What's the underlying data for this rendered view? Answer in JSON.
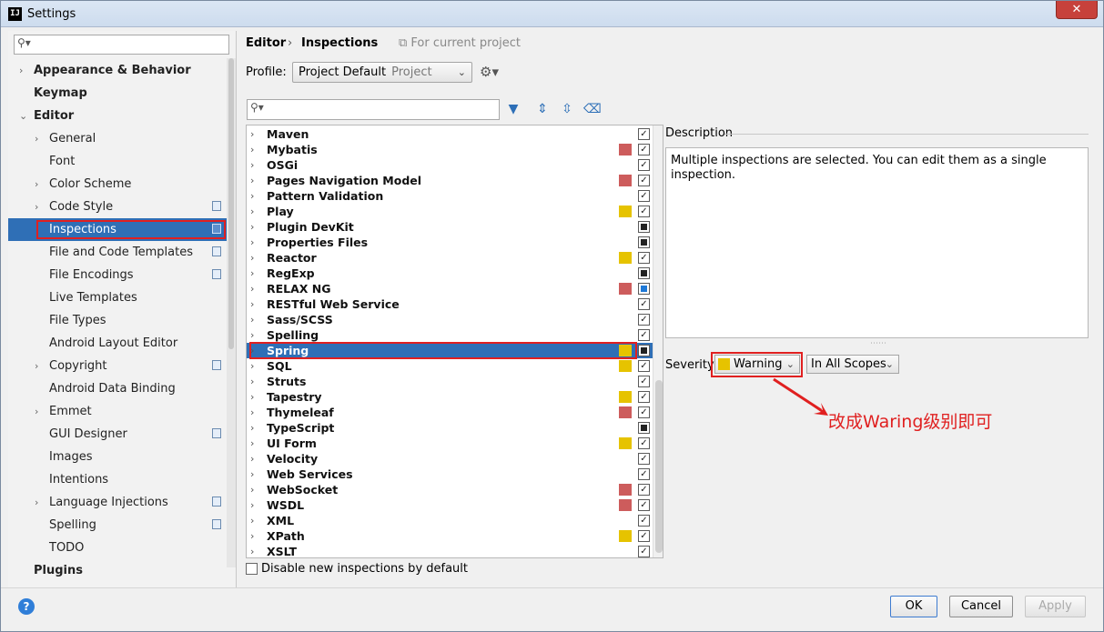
{
  "window": {
    "title": "Settings",
    "app_icon": "IJ",
    "close_label": "✕"
  },
  "left": {
    "search_placeholder": "",
    "tree": [
      {
        "label": "Appearance & Behavior",
        "bold": true,
        "arrow": "›",
        "indent": 0
      },
      {
        "label": "Keymap",
        "bold": true,
        "arrow": "",
        "indent": 0
      },
      {
        "label": "Editor",
        "bold": true,
        "arrow": "⌄",
        "indent": 0
      },
      {
        "label": "General",
        "arrow": "›",
        "indent": 1
      },
      {
        "label": "Font",
        "arrow": "",
        "indent": 1
      },
      {
        "label": "Color Scheme",
        "arrow": "›",
        "indent": 1
      },
      {
        "label": "Code Style",
        "arrow": "›",
        "indent": 1,
        "copy": true
      },
      {
        "label": "Inspections",
        "arrow": "",
        "indent": 1,
        "copy": true,
        "selected": true
      },
      {
        "label": "File and Code Templates",
        "arrow": "",
        "indent": 1,
        "copy": true
      },
      {
        "label": "File Encodings",
        "arrow": "",
        "indent": 1,
        "copy": true
      },
      {
        "label": "Live Templates",
        "arrow": "",
        "indent": 1
      },
      {
        "label": "File Types",
        "arrow": "",
        "indent": 1
      },
      {
        "label": "Android Layout Editor",
        "arrow": "",
        "indent": 1
      },
      {
        "label": "Copyright",
        "arrow": "›",
        "indent": 1,
        "copy": true
      },
      {
        "label": "Android Data Binding",
        "arrow": "",
        "indent": 1
      },
      {
        "label": "Emmet",
        "arrow": "›",
        "indent": 1
      },
      {
        "label": "GUI Designer",
        "arrow": "",
        "indent": 1,
        "copy": true
      },
      {
        "label": "Images",
        "arrow": "",
        "indent": 1
      },
      {
        "label": "Intentions",
        "arrow": "",
        "indent": 1
      },
      {
        "label": "Language Injections",
        "arrow": "›",
        "indent": 1,
        "copy": true
      },
      {
        "label": "Spelling",
        "arrow": "",
        "indent": 1,
        "copy": true
      },
      {
        "label": "TODO",
        "arrow": "",
        "indent": 1
      },
      {
        "label": "Plugins",
        "bold": true,
        "arrow": "",
        "indent": 0
      }
    ]
  },
  "breadcrumb": {
    "editor": "Editor",
    "sep": "›",
    "inspections": "Inspections",
    "scope_note": "⧉ For current project"
  },
  "profile": {
    "label": "Profile:",
    "value": "Project Default",
    "scope": "Project"
  },
  "inspections": [
    {
      "name": "Maven",
      "swatch": "",
      "check": "checked"
    },
    {
      "name": "Mybatis",
      "swatch": "#cd5c5c",
      "check": "checked"
    },
    {
      "name": "OSGi",
      "swatch": "",
      "check": "checked"
    },
    {
      "name": "Pages Navigation Model",
      "swatch": "#cd5c5c",
      "check": "checked"
    },
    {
      "name": "Pattern Validation",
      "swatch": "",
      "check": "checked"
    },
    {
      "name": "Play",
      "swatch": "#e6c300",
      "check": "checked"
    },
    {
      "name": "Plugin DevKit",
      "swatch": "",
      "check": "partial"
    },
    {
      "name": "Properties Files",
      "swatch": "",
      "check": "partial"
    },
    {
      "name": "Reactor",
      "swatch": "#e6c300",
      "check": "checked"
    },
    {
      "name": "RegExp",
      "swatch": "",
      "check": "partial"
    },
    {
      "name": "RELAX NG",
      "swatch": "#cd5c5c",
      "check": "partial-blue"
    },
    {
      "name": "RESTful Web Service",
      "swatch": "",
      "check": "checked"
    },
    {
      "name": "Sass/SCSS",
      "swatch": "",
      "check": "checked"
    },
    {
      "name": "Spelling",
      "swatch": "",
      "check": "checked"
    },
    {
      "name": "Spring",
      "swatch": "#e6c300",
      "check": "partial",
      "selected": true
    },
    {
      "name": "SQL",
      "swatch": "#e6c300",
      "check": "checked"
    },
    {
      "name": "Struts",
      "swatch": "",
      "check": "checked"
    },
    {
      "name": "Tapestry",
      "swatch": "#e6c300",
      "check": "checked"
    },
    {
      "name": "Thymeleaf",
      "swatch": "#cd5c5c",
      "check": "checked"
    },
    {
      "name": "TypeScript",
      "swatch": "",
      "check": "partial"
    },
    {
      "name": "UI Form",
      "swatch": "#e6c300",
      "check": "checked"
    },
    {
      "name": "Velocity",
      "swatch": "",
      "check": "checked"
    },
    {
      "name": "Web Services",
      "swatch": "",
      "check": "checked"
    },
    {
      "name": "WebSocket",
      "swatch": "#cd5c5c",
      "check": "checked"
    },
    {
      "name": "WSDL",
      "swatch": "#cd5c5c",
      "check": "checked"
    },
    {
      "name": "XML",
      "swatch": "",
      "check": "checked"
    },
    {
      "name": "XPath",
      "swatch": "#e6c300",
      "check": "checked"
    },
    {
      "name": "XSLT",
      "swatch": "",
      "check": "checked"
    }
  ],
  "disable_label": "Disable new inspections by default",
  "description": {
    "label": "Description",
    "text": "Multiple inspections are selected. You can edit them as a single inspection."
  },
  "severity": {
    "label": "Severity:",
    "value": "Warning",
    "color": "#e6c300",
    "scope": "In All Scopes"
  },
  "annotation": "改成Waring级别即可",
  "buttons": {
    "ok": "OK",
    "cancel": "Cancel",
    "apply": "Apply",
    "help": "?"
  }
}
